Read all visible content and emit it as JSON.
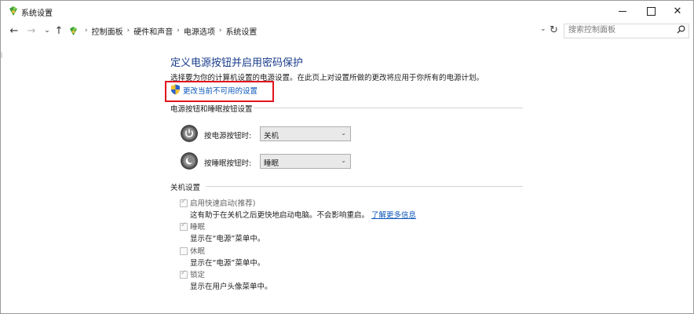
{
  "window": {
    "title": "系统设置"
  },
  "address": {
    "crumbs": [
      "控制面板",
      "硬件和声音",
      "电源选项",
      "系统设置"
    ],
    "search_placeholder": "搜索控制面板"
  },
  "page": {
    "heading": "定义电源按钮并启用密码保护",
    "description": "选择要为你的计算机设置的电源设置。在此页上对设置所做的更改将应用于你所有的电源计划。",
    "admin_link": "更改当前不可用的设置"
  },
  "buttons_section": {
    "title": "电源按钮和睡眠按钮设置",
    "power_button": {
      "label": "按电源按钮时:",
      "value": "关机"
    },
    "sleep_button": {
      "label": "按睡眠按钮时:",
      "value": "睡眠"
    }
  },
  "shutdown_section": {
    "title": "关机设置",
    "items": [
      {
        "label": "启用快速启动(推荐)",
        "desc": "这有助于在关机之后更快地启动电脑。不会影响重启。",
        "link": "了解更多信息",
        "checked": true
      },
      {
        "label": "睡眠",
        "desc": "显示在“电源”菜单中。",
        "checked": true
      },
      {
        "label": "休眠",
        "desc": "显示在“电源”菜单中。",
        "checked": false
      },
      {
        "label": "锁定",
        "desc": "显示在用户头像菜单中。",
        "checked": true
      }
    ]
  },
  "icons": {
    "app": "control-panel-icon",
    "shield": "uac-shield-icon",
    "power": "power-icon",
    "sleep": "sleep-moon-icon"
  },
  "colors": {
    "heading": "#1a3c8c",
    "link": "#0a56b9",
    "highlight": "#e0141e"
  }
}
